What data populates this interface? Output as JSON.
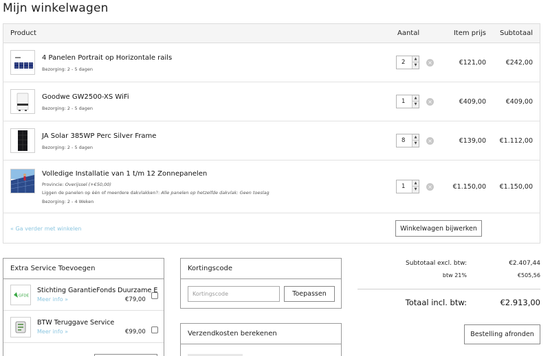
{
  "page": {
    "title": "Mijn winkelwagen"
  },
  "cart": {
    "headers": {
      "product": "Product",
      "quantity": "Aantal",
      "item_price": "Item prijs",
      "subtotal": "Subtotaal"
    },
    "items": [
      {
        "name": "4 Panelen Portrait op Horizontale rails",
        "delivery": "Bezorging: 2 - 5 dagen",
        "quantity": "2",
        "price": "€121,00",
        "subtotal": "€242,00",
        "icon": "solar-rails-image"
      },
      {
        "name": "Goodwe GW2500-XS WiFi",
        "delivery": "Bezorging: 2 - 5 dagen",
        "quantity": "1",
        "price": "€409,00",
        "subtotal": "€409,00",
        "icon": "inverter-image"
      },
      {
        "name": "JA Solar 385WP Perc Silver Frame",
        "delivery": "Bezorging: 2 - 5 dagen",
        "quantity": "8",
        "price": "€139,00",
        "subtotal": "€1.112,00",
        "icon": "solar-panel-image"
      },
      {
        "name": "Volledige Installatie van 1 t/m 12 Zonnepanelen",
        "option1_label": "Provincie:",
        "option1_value": "Overijssel (+€50,00)",
        "option2_label": "Liggen de panelen op één of meerdere dakvlakken?:",
        "option2_value": "Alle panelen op hetzelfde dakvlak: Geen toeslag",
        "delivery": "Bezorging: 2 - 4 Weken",
        "quantity": "1",
        "price": "€1.150,00",
        "subtotal": "€1.150,00",
        "icon": "installation-image"
      }
    ],
    "continue_link": "« Ga verder met winkelen",
    "update_button": "Winkelwagen bijwerken"
  },
  "extra_service": {
    "title": "Extra Service Toevoegen",
    "items": [
      {
        "name": "Stichting GarantieFonds Duurzame Energie",
        "more": "Meer info »",
        "price": "€79,00",
        "logo": "GFDE"
      },
      {
        "name": "BTW Teruggave Service",
        "more": "Meer info »",
        "price": "€99,00",
        "logo": "btw-service-logo"
      }
    ]
  },
  "coupon": {
    "title": "Kortingscode",
    "placeholder": "Kortingscode",
    "apply_button": "Toepassen"
  },
  "shipping": {
    "title": "Verzendkosten berekenen"
  },
  "totals": {
    "subtotal_label": "Subtotaal excl. btw:",
    "subtotal_value": "€2.407,44",
    "vat_label": "btw 21%",
    "vat_value": "€505,56",
    "total_label": "Totaal incl. btw:",
    "total_value": "€2.913,00",
    "checkout_button": "Bestelling afronden"
  },
  "colors": {
    "link": "#8cc6e0",
    "header_bg": "#f5f5f5",
    "border": "#dcdcdc"
  }
}
